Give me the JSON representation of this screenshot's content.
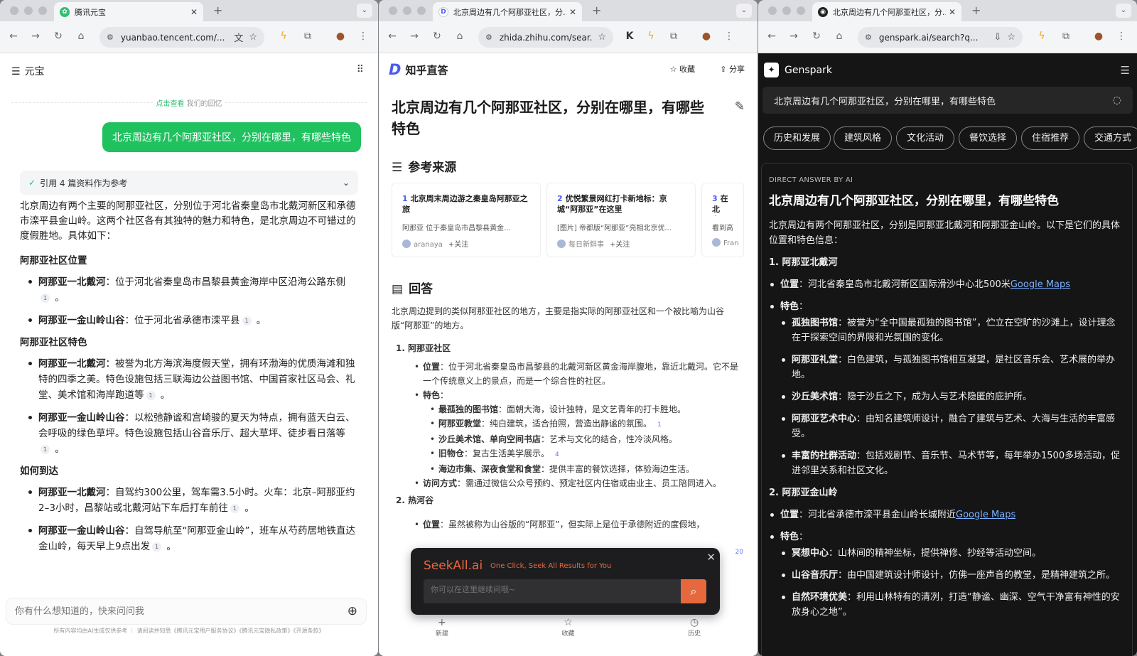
{
  "w1": {
    "tab_title": "腾讯元宝",
    "url": "yuanbao.tencent.com/...",
    "app_name": "元宝",
    "memory_link": "点击查看",
    "memory_text": "我们的回忆",
    "user_msg": "北京周边有几个阿那亚社区，分别在哪里，有哪些特色",
    "ref_bar": "引用 4 篇资料作为参考",
    "intro": "北京周边有两个主要的阿那亚社区，分别位于河北省秦皇岛市北戴河新区和承德市滦平县金山岭。这两个社区各有其独特的魅力和特色，是北京周边不可错过的度假胜地。具体如下：",
    "sections": [
      {
        "title": "阿那亚社区位置",
        "items": [
          {
            "k": "阿那亚一北戴河",
            "v": "：位于河北省秦皇岛市昌黎县黄金海岸中区沿海公路东侧",
            "c": "1"
          },
          {
            "k": "阿那亚一金山岭山谷",
            "v": "：位于河北省承德市滦平县",
            "c": "1"
          }
        ]
      },
      {
        "title": "阿那亚社区特色",
        "items": [
          {
            "k": "阿那亚一北戴河",
            "v": "：被誉为北方海滨海度假天堂，拥有环渤海的优质海滩和独特的四季之美。特色设施包括三联海边公益图书馆、中国首家社区马会、礼堂、美术馆和海岸跑道等",
            "c": "1"
          },
          {
            "k": "阿那亚一金山岭山谷",
            "v": "：以松弛静谧和宫崎骏的夏天为特点，拥有蓝天白云、会呼吸的绿色草坪。特色设施包括山谷音乐厅、超大草坪、徒步看日落等",
            "c": "1"
          }
        ]
      },
      {
        "title": "如何到达",
        "items": [
          {
            "k": "阿那亚一北戴河",
            "v": "：自驾约300公里，驾车需3.5小时。火车：北京–阿那亚约2–3小时，昌黎站或北戴河站下车后打车前往",
            "c": "1"
          },
          {
            "k": "阿那亚一金山岭山谷",
            "v": "：自驾导航至“阿那亚金山岭”，班车从芍药居地铁直达金山岭，每天早上9点出发",
            "c": "1"
          }
        ]
      }
    ],
    "input_placeholder": "你有什么想知道的，快来问问我",
    "footer": "所有内容均由AI生成仅供参考 ｜ 请阅读并知悉《腾讯元宝用户服务协议》《腾讯元宝隐私政策》《开源条款》"
  },
  "w2": {
    "tab_title": "北京周边有几个阿那亚社区，分...",
    "url": "zhida.zhihu.com/sear...",
    "brand": "知乎直答",
    "fav_label": "收藏",
    "share_label": "分享",
    "title": "北京周边有几个阿那亚社区，分别在哪里，有哪些特色",
    "refs_heading": "参考来源",
    "refs": [
      {
        "n": "1",
        "t": "北京周末周边游之秦皇岛阿那亚之旅",
        "d": "阿那亚 位于秦皇岛市昌黎县黄金...",
        "a": "aranaya",
        "f": "+关注"
      },
      {
        "n": "2",
        "t": "优悦繁景网红打卡新地标：京城“阿那亚”在这里",
        "d": "[图片] 帝都版“阿那亚”亮相北京优...",
        "a": "每日新鲜事",
        "f": "+关注"
      },
      {
        "n": "3",
        "t": "在北京…验?",
        "d": "看到高…",
        "a": "Fran",
        "f": ""
      }
    ],
    "answer_heading": "回答",
    "answer_intro": "北京周边提到的类似阿那亚社区的地方，主要是指实际的阿那亚社区和一个被比喻为山谷版“阿那亚”的地方。",
    "s1": "1. 阿那亚社区",
    "loc_k": "位置",
    "loc_v": "：位于河北省秦皇岛市昌黎县的北戴河新区黄金海岸腹地，靠近北戴河。它不是一个传统意义上的景点，而是一个综合性的社区。",
    "feat_k": "特色",
    "feat_v": "：",
    "feats": [
      {
        "k": "最孤独的图书馆",
        "v": "：面朝大海，设计独特，是文艺青年的打卡胜地。",
        "c": ""
      },
      {
        "k": "阿那亚教堂",
        "v": "：纯白建筑，适合拍照，营造出静谧的氛围。",
        "c": "1"
      },
      {
        "k": "沙丘美术馆、单向空间书店",
        "v": "：艺术与文化的结合，性冷淡风格。",
        "c": ""
      },
      {
        "k": "旧物仓",
        "v": "：复古生活美学展示。",
        "c": "4"
      },
      {
        "k": "海边市集、深夜食堂和食堂",
        "v": "：提供丰富的餐饮选择，体验海边生活。",
        "c": ""
      }
    ],
    "visit_k": "访问方式",
    "visit_v": "：需通过微信公众号预约、预定社区内住宿或由业主、员工陪同进入。",
    "s2": "2. 热河谷",
    "loc2_k": "位置",
    "loc2_v": "：虽然被称为山谷版的“阿那亚”，但实际上是位于承德附近的度假地，",
    "cite20": "20",
    "popup": {
      "logo": "SeekAll.ai",
      "slogan": "One Click, Seek All Results for You",
      "placeholder": "你可以在这里继续问哦~"
    },
    "nav": [
      "新建",
      "收藏",
      "历史"
    ]
  },
  "w3": {
    "tab_title": "北京周边有几个阿那亚社区，分...",
    "url": "genspark.ai/search?q...",
    "brand": "Genspark",
    "query": "北京周边有几个阿那亚社区，分别在哪里，有哪些特色",
    "chips": [
      "历史和发展",
      "建筑风格",
      "文化活动",
      "餐饮选择",
      "住宿推荐",
      "交通方式"
    ],
    "label": "DIRECT ANSWER BY AI",
    "title": "北京周边有几个阿那亚社区，分别在哪里，有哪些特色",
    "intro": "北京周边有两个阿那亚社区，分别是阿那亚北戴河和阿那亚金山岭。以下是它们的具体位置和特色信息：",
    "s1": "1. 阿那亚北戴河",
    "loc_k": "位置",
    "loc_v": "：河北省秦皇岛市北戴河新区国际滑沙中心北500米",
    "maps": "Google Maps",
    "feat_k": "特色",
    "feat_v": "：",
    "feats": [
      {
        "k": "孤独图书馆",
        "v": "：被誉为“全中国最孤独的图书馆”，伫立在空旷的沙滩上，设计理念在于探索空间的界限和光氛围的变化。"
      },
      {
        "k": "阿那亚礼堂",
        "v": "：白色建筑，与孤独图书馆相互凝望，是社区音乐会、艺术展的举办地。"
      },
      {
        "k": "沙丘美术馆",
        "v": "：隐于沙丘之下，成为人与艺术隐匿的庇护所。"
      },
      {
        "k": "阿那亚艺术中心",
        "v": "：由知名建筑师设计，融合了建筑与艺术、大海与生活的丰富感受。"
      },
      {
        "k": "丰富的社群活动",
        "v": "：包括戏剧节、音乐节、马术节等，每年举办1500多场活动，促进邻里关系和社区文化。"
      }
    ],
    "s2": "2. 阿那亚金山岭",
    "loc2_k": "位置",
    "loc2_v": "：河北省承德市滦平县金山岭长城附近",
    "feats2": [
      {
        "k": "冥想中心",
        "v": "：山林间的精神坐标，提供禅修、抄经等活动空间。"
      },
      {
        "k": "山谷音乐厅",
        "v": "：由中国建筑设计师设计，仿佛一座声音的教堂，是精神建筑之所。"
      },
      {
        "k": "自然环境优美",
        "v": "：利用山林特有的清冽，打造“静谧、幽深、空气干净富有神性的安放身心之地”。"
      }
    ]
  }
}
